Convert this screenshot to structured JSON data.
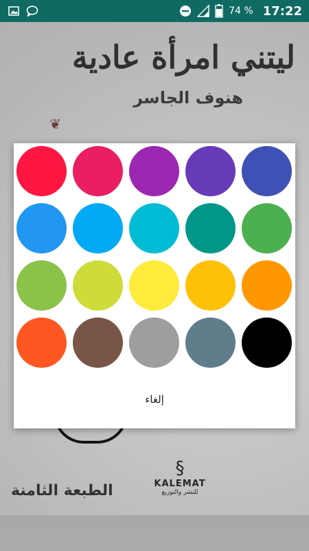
{
  "status_bar": {
    "battery": "74 %",
    "time": "17:22",
    "icons": [
      "image-icon",
      "chat-bubble-icon",
      "do-not-disturb-icon",
      "signal-icon",
      "battery-icon"
    ]
  },
  "cover": {
    "title": "ليتني امرأة عادية",
    "author": "هنوف الجاسر",
    "edition": "الطبعة الثامنة",
    "publisher": "KALEMAT",
    "publisher_tagline": "للنشر والتوزيع"
  },
  "dialog": {
    "colors": [
      "#FF1744",
      "#E91E63",
      "#9C27B0",
      "#673AB7",
      "#3F51B5",
      "#2196F3",
      "#03A9F4",
      "#00BCD4",
      "#009688",
      "#4CAF50",
      "#8BC34A",
      "#CDDC39",
      "#FFEB3B",
      "#FFC107",
      "#FF9800",
      "#FF5722",
      "#795548",
      "#9E9E9E",
      "#607D8B",
      "#000000"
    ],
    "cancel_label": "إلغاء"
  }
}
